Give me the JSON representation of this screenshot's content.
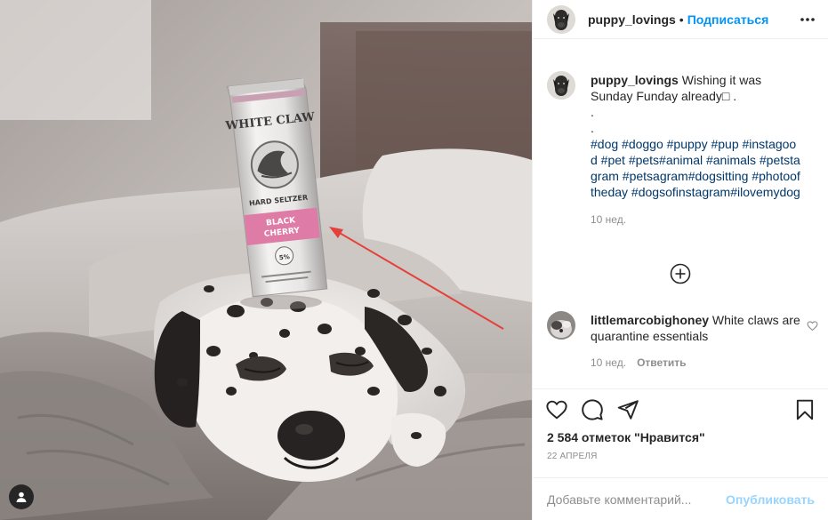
{
  "post": {
    "author": "puppy_lovings",
    "follow_label": "Подписаться",
    "separator": "•",
    "image_alt": "Dalmatian sleeping on a bed with a White Claw Black Cherry can balanced on its head"
  },
  "can_text": {
    "brand_line1": "WHITE CLAW",
    "brand_line2": "HARD SELTZER",
    "flavor_line1": "BLACK",
    "flavor_line2": "CHERRY",
    "abv": "5%"
  },
  "caption": {
    "username": "puppy_lovings",
    "text": "Wishing it was Sunday Funday already□ .",
    "dots": [
      ".",
      "."
    ],
    "hashtags": "#dog #doggo #puppy #pup  #instagood  #pet #pets#animal #animals #petstagram #petsagram#dogsitting #photooftheday #dogsofinstagram#ilovemydog",
    "time": "10 нед."
  },
  "comments": [
    {
      "username": "littlemarcobighoney",
      "text": "White claws are quarantine essentials",
      "time": "10 нед.",
      "reply_label": "Ответить"
    }
  ],
  "stats": {
    "likes": "2 584 отметок \"Нравится\"",
    "date": "22 апреля"
  },
  "composer": {
    "placeholder": "Добавьте комментарий...",
    "post_label": "Опубликовать"
  },
  "icons": {
    "more": "more-horizontal-icon",
    "like": "heart-icon",
    "comment": "comment-bubble-icon",
    "share": "paper-plane-icon",
    "save": "bookmark-icon",
    "load_more": "plus-circle-icon",
    "tagged_users": "user-tag-icon"
  },
  "colors": {
    "link_blue": "#0095f6",
    "hashtag_blue": "#00376b",
    "muted": "#8e8e8e",
    "text": "#262626",
    "can_pink": "#e0568f",
    "arrow_red": "#e5403a"
  }
}
